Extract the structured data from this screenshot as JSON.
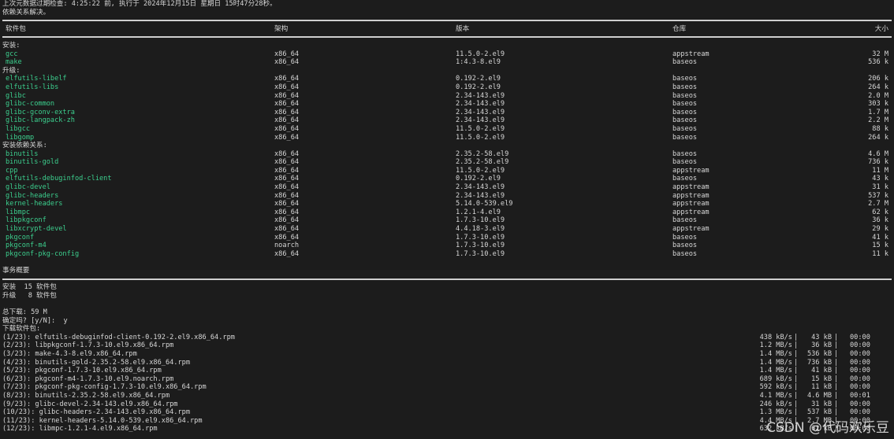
{
  "header": {
    "meta_line": "上次元数据过期检查: 4:25:22 前, 执行于 2024年12月15日 星期日 15时47分28秒。",
    "resolved": "依赖关系解决。"
  },
  "columns": {
    "package": "软件包",
    "arch": "架构",
    "version": "版本",
    "repo": "仓库",
    "size": "大小"
  },
  "sections": [
    {
      "title": "安装:",
      "rows": [
        {
          "name": "gcc",
          "arch": "x86_64",
          "version": "11.5.0-2.el9",
          "repo": "appstream",
          "size": "32 M"
        },
        {
          "name": "make",
          "arch": "x86_64",
          "version": "1:4.3-8.el9",
          "repo": "baseos",
          "size": "536 k"
        }
      ]
    },
    {
      "title": "升级:",
      "rows": [
        {
          "name": "elfutils-libelf",
          "arch": "x86_64",
          "version": "0.192-2.el9",
          "repo": "baseos",
          "size": "206 k"
        },
        {
          "name": "elfutils-libs",
          "arch": "x86_64",
          "version": "0.192-2.el9",
          "repo": "baseos",
          "size": "264 k"
        },
        {
          "name": "glibc",
          "arch": "x86_64",
          "version": "2.34-143.el9",
          "repo": "baseos",
          "size": "2.0 M"
        },
        {
          "name": "glibc-common",
          "arch": "x86_64",
          "version": "2.34-143.el9",
          "repo": "baseos",
          "size": "303 k"
        },
        {
          "name": "glibc-gconv-extra",
          "arch": "x86_64",
          "version": "2.34-143.el9",
          "repo": "baseos",
          "size": "1.7 M"
        },
        {
          "name": "glibc-langpack-zh",
          "arch": "x86_64",
          "version": "2.34-143.el9",
          "repo": "baseos",
          "size": "2.2 M"
        },
        {
          "name": "libgcc",
          "arch": "x86_64",
          "version": "11.5.0-2.el9",
          "repo": "baseos",
          "size": "88 k"
        },
        {
          "name": "libgomp",
          "arch": "x86_64",
          "version": "11.5.0-2.el9",
          "repo": "baseos",
          "size": "264 k"
        }
      ]
    },
    {
      "title": "安装依赖关系:",
      "rows": [
        {
          "name": "binutils",
          "arch": "x86_64",
          "version": "2.35.2-58.el9",
          "repo": "baseos",
          "size": "4.6 M"
        },
        {
          "name": "binutils-gold",
          "arch": "x86_64",
          "version": "2.35.2-58.el9",
          "repo": "baseos",
          "size": "736 k"
        },
        {
          "name": "cpp",
          "arch": "x86_64",
          "version": "11.5.0-2.el9",
          "repo": "appstream",
          "size": "11 M"
        },
        {
          "name": "elfutils-debuginfod-client",
          "arch": "x86_64",
          "version": "0.192-2.el9",
          "repo": "baseos",
          "size": "43 k"
        },
        {
          "name": "glibc-devel",
          "arch": "x86_64",
          "version": "2.34-143.el9",
          "repo": "appstream",
          "size": "31 k"
        },
        {
          "name": "glibc-headers",
          "arch": "x86_64",
          "version": "2.34-143.el9",
          "repo": "appstream",
          "size": "537 k"
        },
        {
          "name": "kernel-headers",
          "arch": "x86_64",
          "version": "5.14.0-539.el9",
          "repo": "appstream",
          "size": "2.7 M"
        },
        {
          "name": "libmpc",
          "arch": "x86_64",
          "version": "1.2.1-4.el9",
          "repo": "appstream",
          "size": "62 k"
        },
        {
          "name": "libpkgconf",
          "arch": "x86_64",
          "version": "1.7.3-10.el9",
          "repo": "baseos",
          "size": "36 k"
        },
        {
          "name": "libxcrypt-devel",
          "arch": "x86_64",
          "version": "4.4.18-3.el9",
          "repo": "appstream",
          "size": "29 k"
        },
        {
          "name": "pkgconf",
          "arch": "x86_64",
          "version": "1.7.3-10.el9",
          "repo": "baseos",
          "size": "41 k"
        },
        {
          "name": "pkgconf-m4",
          "arch": "noarch",
          "version": "1.7.3-10.el9",
          "repo": "baseos",
          "size": "15 k"
        },
        {
          "name": "pkgconf-pkg-config",
          "arch": "x86_64",
          "version": "1.7.3-10.el9",
          "repo": "baseos",
          "size": "11 k"
        }
      ]
    }
  ],
  "summary": {
    "title": "事务概要",
    "install": "安装  15 软件包",
    "upgrade": "升级   8 软件包",
    "total_download": "总下载: 59 M",
    "confirm": "确定吗? [y/N]:  y",
    "downloading": "下载软件包:"
  },
  "downloads": [
    {
      "file": "(1/23): elfutils-debuginfod-client-0.192-2.el9.x86_64.rpm",
      "speed": "438 kB/s",
      "size": "43 kB",
      "time": "00:00"
    },
    {
      "file": "(2/23): libpkgconf-1.7.3-10.el9.x86_64.rpm",
      "speed": "1.2 MB/s",
      "size": "36 kB",
      "time": "00:00"
    },
    {
      "file": "(3/23): make-4.3-8.el9.x86_64.rpm",
      "speed": "1.4 MB/s",
      "size": "536 kB",
      "time": "00:00"
    },
    {
      "file": "(4/23): binutils-gold-2.35.2-58.el9.x86_64.rpm",
      "speed": "1.4 MB/s",
      "size": "736 kB",
      "time": "00:00"
    },
    {
      "file": "(5/23): pkgconf-1.7.3-10.el9.x86_64.rpm",
      "speed": "1.4 MB/s",
      "size": "41 kB",
      "time": "00:00"
    },
    {
      "file": "(6/23): pkgconf-m4-1.7.3-10.el9.noarch.rpm",
      "speed": "689 kB/s",
      "size": "15 kB",
      "time": "00:00"
    },
    {
      "file": "(7/23): pkgconf-pkg-config-1.7.3-10.el9.x86_64.rpm",
      "speed": "592 kB/s",
      "size": "11 kB",
      "time": "00:00"
    },
    {
      "file": "(8/23): binutils-2.35.2-58.el9.x86_64.rpm",
      "speed": "4.1 MB/s",
      "size": "4.6 MB",
      "time": "00:01"
    },
    {
      "file": "(9/23): glibc-devel-2.34-143.el9.x86_64.rpm",
      "speed": "246 kB/s",
      "size": "31 kB",
      "time": "00:00"
    },
    {
      "file": "(10/23): glibc-headers-2.34-143.el9.x86_64.rpm",
      "speed": "1.3 MB/s",
      "size": "537 kB",
      "time": "00:00"
    },
    {
      "file": "(11/23): kernel-headers-5.14.0-539.el9.x86_64.rpm",
      "speed": "4.4 MB/s",
      "size": "2.7 MB",
      "time": "00:00"
    },
    {
      "file": "(12/23): libmpc-1.2.1-4.el9.x86_64.rpm",
      "speed": "632 kB/s",
      "size": "62 kB",
      "time": "00:00"
    }
  ],
  "watermark": "CSDN @代码欢乐豆"
}
